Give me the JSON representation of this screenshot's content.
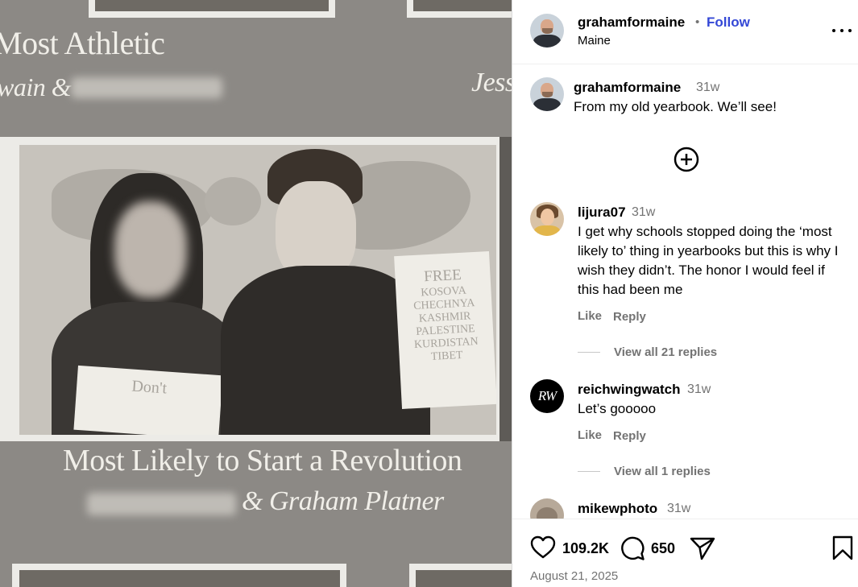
{
  "photo": {
    "caption_top": "Most Athletic",
    "caption_top_names": "wain &",
    "caption_top_right": "Jess",
    "caption_main": "Most Likely to Start a Revolution",
    "caption_names": "& Graham Platner",
    "sign_text": [
      "FREE",
      "KOSOVA",
      "CHECHNYA",
      "KASHMIR",
      "PALESTINE",
      "KURDISTAN",
      "TIBET"
    ]
  },
  "post": {
    "author": "grahamformaine",
    "follow_label": "Follow",
    "location": "Maine",
    "caption_author": "grahamformaine",
    "caption_time": "31w",
    "caption_text": "From my old yearbook. We’ll see!",
    "likes": "109.2K",
    "comments_count": "650",
    "date": "August 21, 2025"
  },
  "comments": [
    {
      "user": "lijura07",
      "time": "31w",
      "text": "I get why schools stopped doing the ‘most likely to’ thing in yearbooks but this is why I wish they didn’t. The honor I would feel if this had been me",
      "like_label": "Like",
      "reply_label": "Reply",
      "replies_label": "View all 21 replies"
    },
    {
      "user": "reichwingwatch",
      "time": "31w",
      "text": "Let’s gooooo",
      "like_label": "Like",
      "reply_label": "Reply",
      "replies_label": "View all 1 replies"
    },
    {
      "user": "mikewphoto",
      "time": "31w"
    }
  ],
  "icons": {
    "more": "more-options-icon",
    "add": "add-comment-icon",
    "like": "heart-icon",
    "comment": "comment-icon",
    "share": "send-icon",
    "save": "bookmark-icon"
  },
  "colors": {
    "follow": "#3448d6",
    "muted": "#737373"
  }
}
